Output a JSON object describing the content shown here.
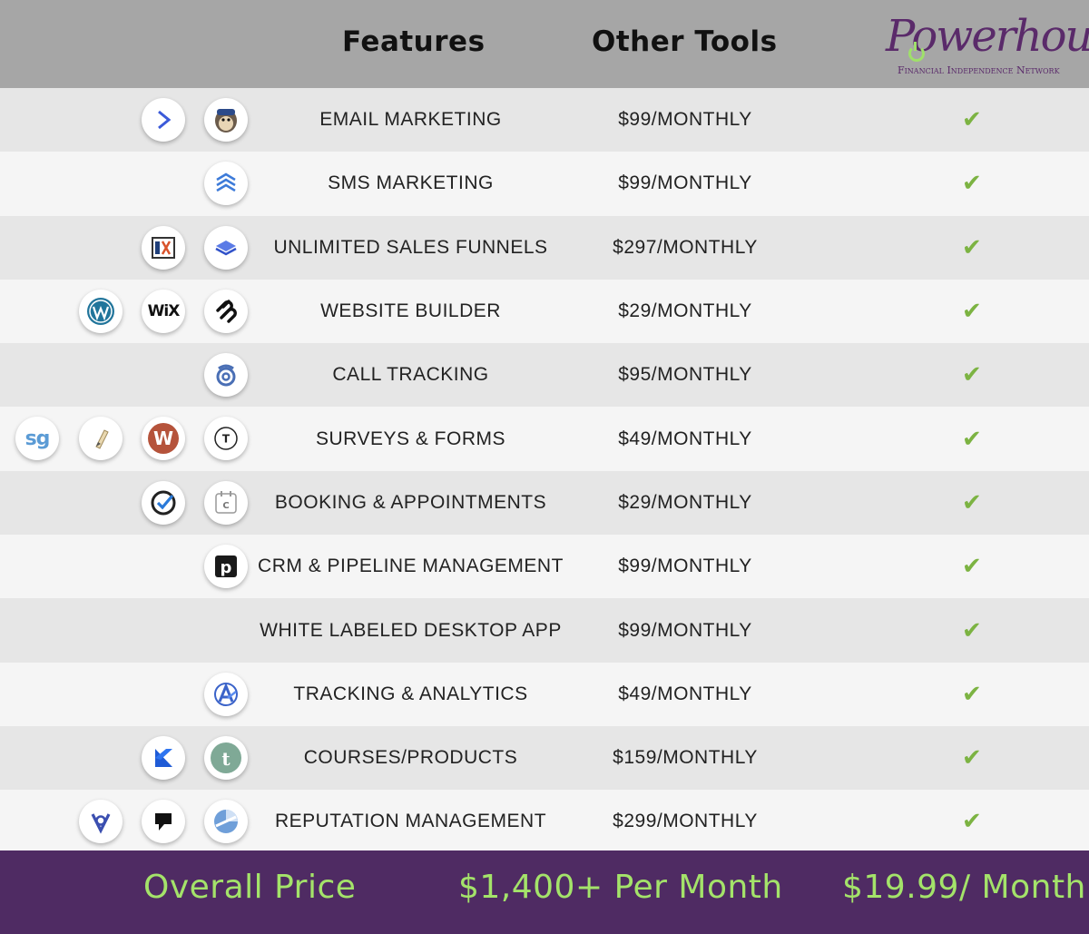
{
  "header": {
    "features_label": "Features",
    "other_tools_label": "Other Tools",
    "logo_text": "Powerhouse",
    "logo_subtitle": "Financial Independence Network"
  },
  "rows": [
    {
      "feature": "EMAIL MARKETING",
      "price": "$99/MONTHLY",
      "included": true,
      "icons": [
        "activecampaign-icon",
        "mailchimp-icon"
      ]
    },
    {
      "feature": "SMS MARKETING",
      "price": "$99/MONTHLY",
      "included": true,
      "icons": [
        "sms-layers-icon"
      ]
    },
    {
      "feature": "UNLIMITED SALES FUNNELS",
      "price": "$297/MONTHLY",
      "included": true,
      "icons": [
        "clickfunnels-icon",
        "leadpages-icon"
      ]
    },
    {
      "feature": "WEBSITE BUILDER",
      "price": "$29/MONTHLY",
      "included": true,
      "icons": [
        "wordpress-icon",
        "wix-icon",
        "squarespace-icon"
      ]
    },
    {
      "feature": "CALL TRACKING",
      "price": "$95/MONTHLY",
      "included": true,
      "icons": [
        "call-tracking-icon"
      ]
    },
    {
      "feature": "SURVEYS & FORMS",
      "price": "$49/MONTHLY",
      "included": true,
      "icons": [
        "surveygizmo-icon",
        "jotform-icon",
        "wufoo-icon",
        "typeform-icon"
      ]
    },
    {
      "feature": "BOOKING & APPOINTMENTS",
      "price": "$29/MONTHLY",
      "included": true,
      "icons": [
        "acuity-icon",
        "calendly-icon"
      ]
    },
    {
      "feature": "CRM & PIPELINE MANAGEMENT",
      "price": "$99/MONTHLY",
      "included": true,
      "icons": [
        "pipedrive-icon"
      ]
    },
    {
      "feature": "WHITE LABELED DESKTOP APP",
      "price": "$99/MONTHLY",
      "included": true,
      "icons": []
    },
    {
      "feature": "TRACKING & ANALYTICS",
      "price": "$49/MONTHLY",
      "included": true,
      "icons": [
        "analytics-icon"
      ]
    },
    {
      "feature": "COURSES/PRODUCTS",
      "price": "$159/MONTHLY",
      "included": true,
      "icons": [
        "kajabi-icon",
        "teachable-icon"
      ]
    },
    {
      "feature": "REPUTATION MANAGEMENT",
      "price": "$299/MONTHLY",
      "included": true,
      "icons": [
        "birdeye-icon",
        "podium-icon",
        "reputation-icon"
      ]
    }
  ],
  "footer": {
    "overall_label": "Overall Price",
    "other_total": "$1,400+ Per Month",
    "powerhouse_total": "$19.99/ Month"
  },
  "colors": {
    "header_bg": "#a6a6a6",
    "footer_bg": "#4f2b63",
    "footer_text": "#a4e36a",
    "check": "#7cb342",
    "row_shade": "#e6e6e6",
    "row_light": "#f5f5f5"
  }
}
